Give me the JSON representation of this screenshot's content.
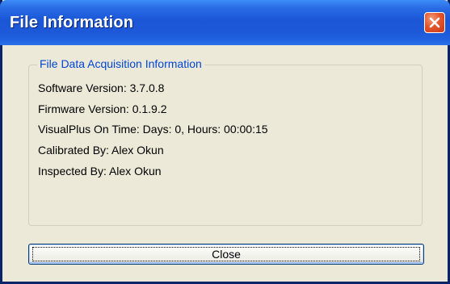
{
  "window": {
    "title": "File Information",
    "close_icon": "close-icon"
  },
  "group": {
    "legend": "File Data Acquisition Information",
    "lines": [
      "Software Version: 3.7.0.8",
      "Firmware Version: 0.1.9.2",
      "VisualPlus On Time: Days: 0, Hours: 00:00:15",
      "Calibrated By: Alex Okun",
      "Inspected By: Alex Okun"
    ]
  },
  "buttons": {
    "close_label": "Close"
  },
  "colors": {
    "titlebar": "#1A56D6",
    "legend_text": "#0046D5",
    "window_bg": "#ECE9D8",
    "close_button": "#E3572C"
  }
}
